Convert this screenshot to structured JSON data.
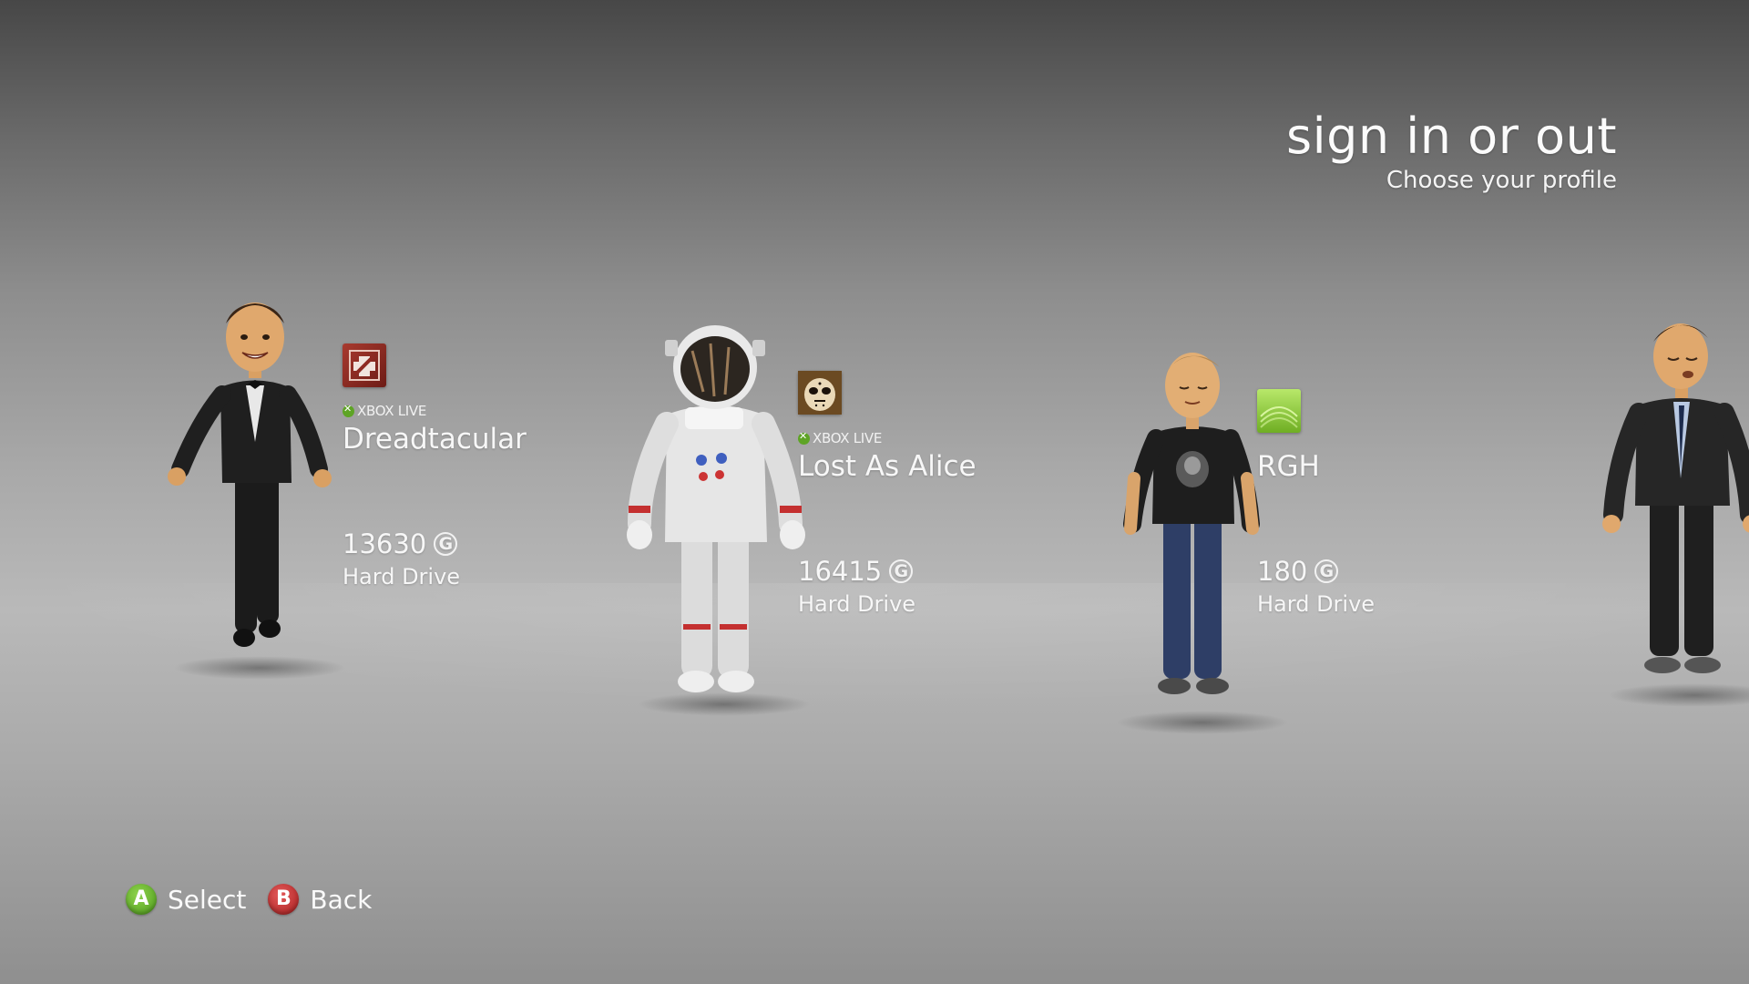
{
  "header": {
    "title": "sign in or out",
    "subtitle": "Choose your profile"
  },
  "profiles": [
    {
      "gamertag": "Dreadtacular",
      "live_label": "XBOX LIVE",
      "gamerscore": "13630",
      "storage": "Hard Drive",
      "gamerpic_icon": "red-cross-emblem-icon",
      "gamerpic_color": "#8e2a22"
    },
    {
      "gamertag": "Lost As Alice",
      "live_label": "XBOX LIVE",
      "gamerscore": "16415",
      "storage": "Hard Drive",
      "gamerpic_icon": "hockey-mask-icon",
      "gamerpic_color": "#c78a35"
    },
    {
      "gamertag": "RGH",
      "gamerscore": "180",
      "storage": "Hard Drive",
      "gamerpic_icon": "green-wave-icon",
      "gamerpic_color": "#8fcf3b"
    }
  ],
  "gamerscore_glyph": "G",
  "footer": {
    "a_glyph": "A",
    "a_label": "Select",
    "b_glyph": "B",
    "b_label": "Back"
  },
  "colors": {
    "button_a": "#5fae25",
    "button_b": "#c62a2a",
    "xbox_live_green": "#5ea425"
  }
}
